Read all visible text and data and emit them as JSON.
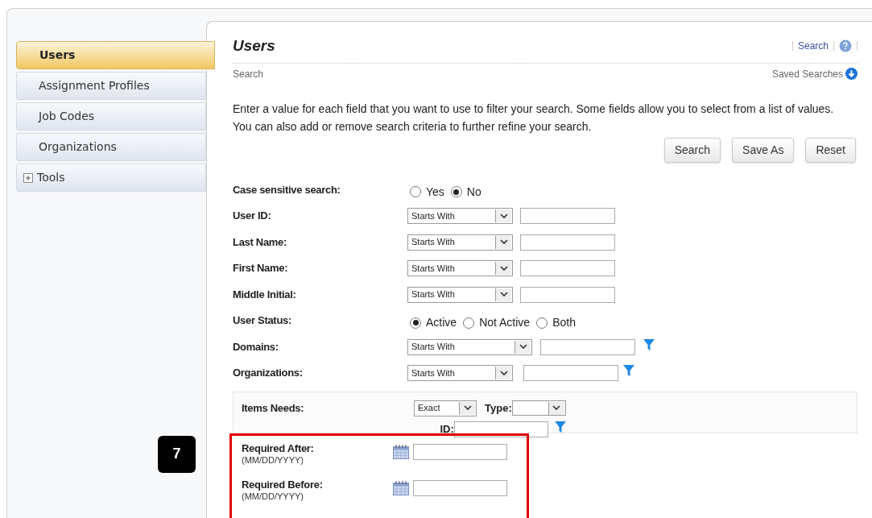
{
  "sidebar": {
    "items": [
      {
        "label": "Users",
        "selected": true,
        "expandable": false
      },
      {
        "label": "Assignment Profiles",
        "selected": false,
        "expandable": false
      },
      {
        "label": "Job Codes",
        "selected": false,
        "expandable": false
      },
      {
        "label": "Organizations",
        "selected": false,
        "expandable": false
      },
      {
        "label": "Tools",
        "selected": false,
        "expandable": true
      }
    ]
  },
  "header": {
    "title": "Users",
    "breadcrumb": "Search",
    "search_link": "Search",
    "saved_searches": "Saved Searches"
  },
  "intro": "Enter a value for each field that you want to use to filter your search. Some fields allow you to select from a list of values. You can also add or remove search criteria to further refine your search.",
  "buttons": [
    "Search",
    "Save As",
    "Reset"
  ],
  "form": {
    "rows": [
      {
        "kind": "radio",
        "label": "Case sensitive search:",
        "options": [
          {
            "label": "Yes",
            "selected": false
          },
          {
            "label": "No",
            "selected": true
          }
        ]
      },
      {
        "kind": "text",
        "label": "User ID:",
        "operator": "Starts With"
      },
      {
        "kind": "text",
        "label": "Last Name:",
        "operator": "Starts With"
      },
      {
        "kind": "text",
        "label": "First Name:",
        "operator": "Starts With"
      },
      {
        "kind": "text",
        "label": "Middle Initial:",
        "operator": "Starts With"
      },
      {
        "kind": "radio",
        "label": "User Status:",
        "options": [
          {
            "label": "Active",
            "selected": true
          },
          {
            "label": "Not Active",
            "selected": false
          },
          {
            "label": "Both",
            "selected": false
          }
        ]
      },
      {
        "kind": "lookup_wide",
        "label": "Domains:",
        "operator": "Starts With"
      },
      {
        "kind": "lookup",
        "label": "Organizations:",
        "operator": "Starts With"
      }
    ],
    "items_needs": {
      "label": "Items Needs:",
      "operator": "Exact",
      "type_label": "Type:",
      "id_label": "ID:"
    },
    "dates": [
      {
        "label": "Required After:",
        "hint": "(MM/DD/YYYY)"
      },
      {
        "label": "Required Before:",
        "hint": "(MM/DD/YYYY)"
      }
    ],
    "callout": "7"
  }
}
